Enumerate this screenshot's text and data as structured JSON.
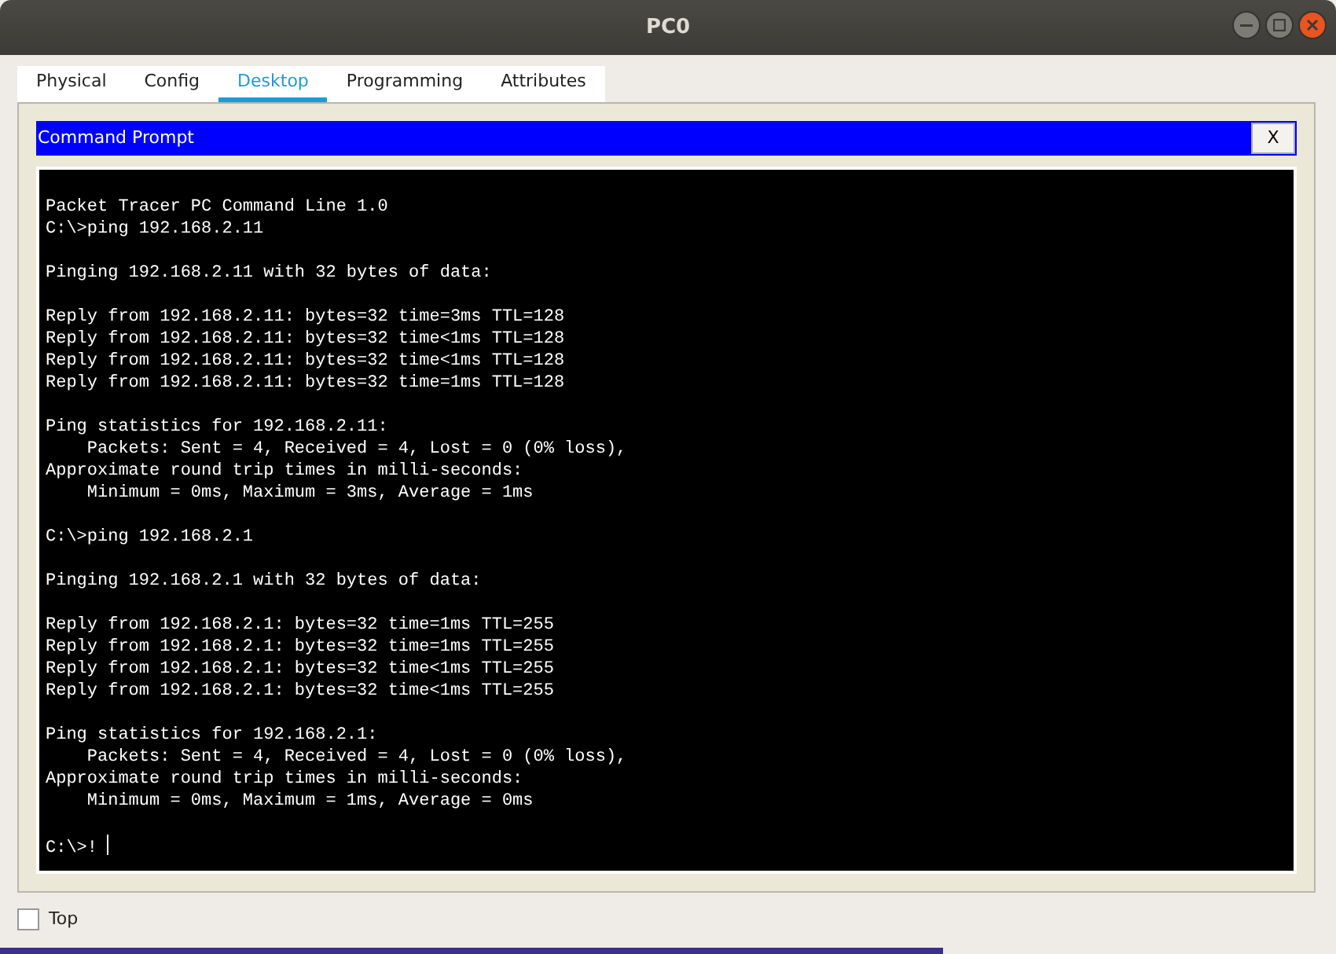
{
  "window": {
    "title": "PC0"
  },
  "tabs": [
    {
      "label": "Physical",
      "selected": false
    },
    {
      "label": "Config",
      "selected": false
    },
    {
      "label": "Desktop",
      "selected": true
    },
    {
      "label": "Programming",
      "selected": false
    },
    {
      "label": "Attributes",
      "selected": false
    }
  ],
  "command_prompt": {
    "title": "Command Prompt",
    "close_label": "X",
    "blocks": [
      [
        "Packet Tracer PC Command Line 1.0",
        "C:\\>ping 192.168.2.11"
      ],
      [
        "Pinging 192.168.2.11 with 32 bytes of data:"
      ],
      [
        "Reply from 192.168.2.11: bytes=32 time=3ms TTL=128",
        "Reply from 192.168.2.11: bytes=32 time<1ms TTL=128",
        "Reply from 192.168.2.11: bytes=32 time<1ms TTL=128",
        "Reply from 192.168.2.11: bytes=32 time=1ms TTL=128"
      ],
      [
        "Ping statistics for 192.168.2.11:",
        "    Packets: Sent = 4, Received = 4, Lost = 0 (0% loss),",
        "Approximate round trip times in milli-seconds:",
        "    Minimum = 0ms, Maximum = 3ms, Average = 1ms"
      ],
      [
        "C:\\>ping 192.168.2.1"
      ],
      [
        "Pinging 192.168.2.1 with 32 bytes of data:"
      ],
      [
        "Reply from 192.168.2.1: bytes=32 time=1ms TTL=255",
        "Reply from 192.168.2.1: bytes=32 time=1ms TTL=255",
        "Reply from 192.168.2.1: bytes=32 time<1ms TTL=255",
        "Reply from 192.168.2.1: bytes=32 time<1ms TTL=255"
      ],
      [
        "Ping statistics for 192.168.2.1:",
        "    Packets: Sent = 4, Received = 4, Lost = 0 (0% loss),",
        "Approximate round trip times in milli-seconds:",
        "    Minimum = 0ms, Maximum = 1ms, Average = 0ms"
      ],
      [
        "C:\\>!"
      ]
    ]
  },
  "top_checkbox": {
    "label": "Top",
    "checked": false
  }
}
